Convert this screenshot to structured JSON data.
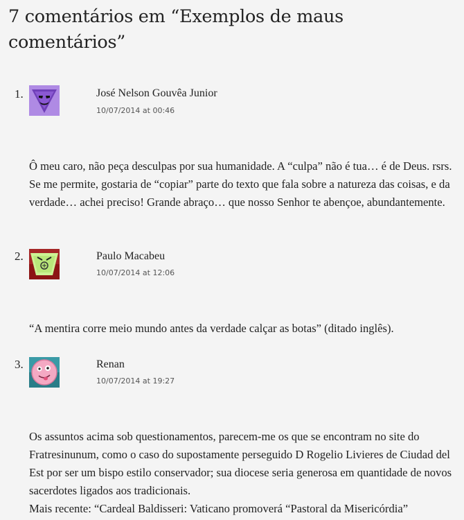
{
  "heading": {
    "title": "7 comentários em “Exemplos de maus comentários”"
  },
  "comments": [
    {
      "number": "1.",
      "author": "José Nelson Gouvêa Junior",
      "date": "10/07/2014 at 00:46",
      "avatar_icon": "purple-triangle-face-avatar-icon",
      "avatar_colors": {
        "bg": "#b48ee0",
        "shape": "#7f4fc3"
      },
      "paragraphs": [
        "Ô meu caro, não peça desculpas por sua humanidade. A “culpa” não é tua… é de Deus. rsrs. Se me permite, gostaria de “copiar” parte do texto que fala sobre a natureza das coisas, e da verdade… achei preciso! Grande abraço… que nosso Senhor te abençoe, abundantemente."
      ]
    },
    {
      "number": "2.",
      "author": "Paulo Macabeu",
      "date": "10/07/2014 at 12:06",
      "avatar_icon": "green-cup-face-avatar-icon",
      "avatar_colors": {
        "bg": "#a01c1c",
        "shape": "#c9f08a"
      },
      "paragraphs": [
        "“A mentira corre meio mundo antes da verdade calçar as botas” (ditado inglês)."
      ]
    },
    {
      "number": "3.",
      "author": "Renan",
      "date": "10/07/2014 at 19:27",
      "avatar_icon": "pink-round-face-avatar-icon",
      "avatar_colors": {
        "bg": "#2d8b98",
        "shape": "#f2a6c0"
      },
      "paragraphs": [
        "Os assuntos acima sob questionamentos, parecem-me os que se encontram no site do Fratresinunum, como o caso do supostamente perseguido D Rogelio Livieres de Ciudad del Est por ser um bispo estilo conservador; sua diocese seria generosa em quantidade de novos sacerdotes ligados aos tradicionais.",
        "Mais recente: “Cardeal Baldisseri: Vaticano promoverá “Pastoral da Misericórdia”"
      ]
    }
  ]
}
